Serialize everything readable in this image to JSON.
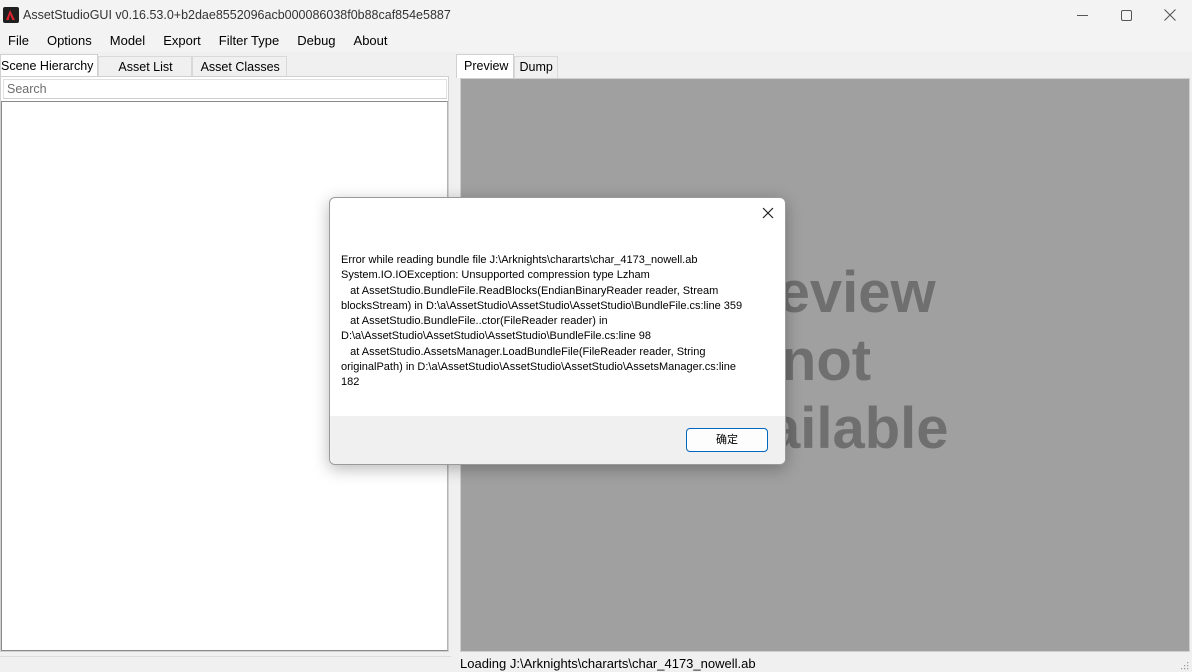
{
  "window": {
    "title": "AssetStudioGUI v0.16.53.0+b2dae8552096acb000086038f0b88caf854e5887",
    "icon": "assetstudio-app-icon",
    "controls": [
      "minimize-icon",
      "maximize-icon",
      "close-icon"
    ]
  },
  "menu": {
    "items": [
      "File",
      "Options",
      "Model",
      "Export",
      "Filter Type",
      "Debug",
      "About"
    ]
  },
  "left_panel": {
    "tabs": [
      "Scene Hierarchy",
      "Asset List",
      "Asset Classes"
    ],
    "active_tab": "Scene Hierarchy",
    "search_placeholder": "Search"
  },
  "right_panel": {
    "tabs": [
      "Preview",
      "Dump"
    ],
    "active_tab": "Preview",
    "preview_message": "Preview\nnot\navailable",
    "status": "Loading J:\\Arknights\\chararts\\char_4173_nowell.ab"
  },
  "dialog": {
    "message": "Error while reading bundle file J:\\Arknights\\chararts\\char_4173_nowell.ab\nSystem.IO.IOException: Unsupported compression type Lzham\n   at AssetStudio.BundleFile.ReadBlocks(EndianBinaryReader reader, Stream\nblocksStream) in D:\\a\\AssetStudio\\AssetStudio\\AssetStudio\\BundleFile.cs:line 359\n   at AssetStudio.BundleFile..ctor(FileReader reader) in\nD:\\a\\AssetStudio\\AssetStudio\\AssetStudio\\BundleFile.cs:line 98\n   at AssetStudio.AssetsManager.LoadBundleFile(FileReader reader, String\noriginalPath) in D:\\a\\AssetStudio\\AssetStudio\\AssetStudio\\AssetsManager.cs:line\n182",
    "ok_label": "确定"
  },
  "colors": {
    "preview_background": "#a0a0a0",
    "preview_text": "#6f6f6f",
    "ok_button_border": "#0067c0"
  }
}
